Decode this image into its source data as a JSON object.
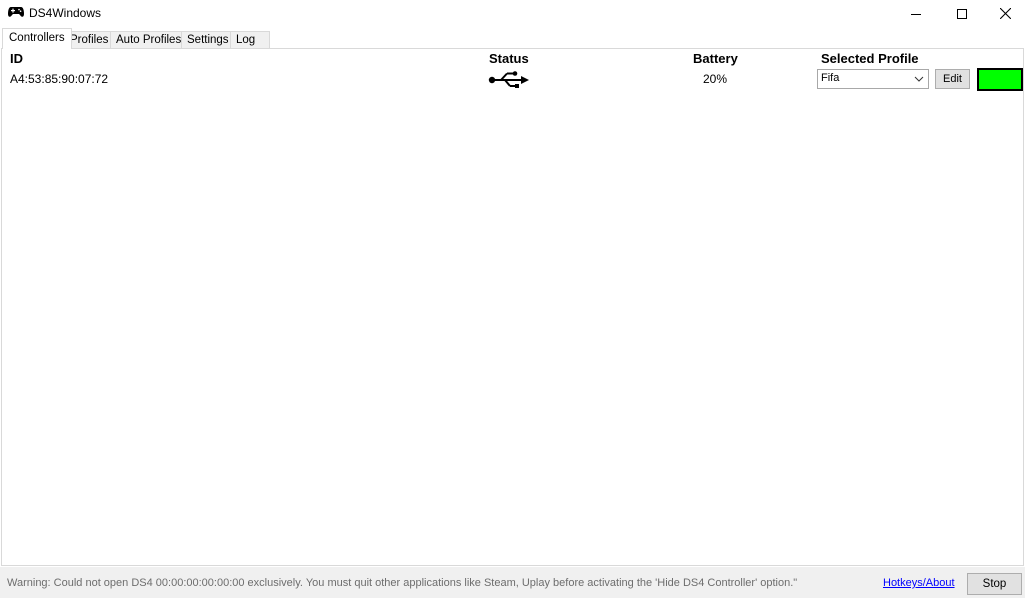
{
  "window": {
    "title": "DS4Windows",
    "icon": "gamepad-icon"
  },
  "tabs": [
    {
      "label": "Controllers",
      "active": true
    },
    {
      "label": "Profiles",
      "active": false
    },
    {
      "label": "Auto Profiles",
      "active": false
    },
    {
      "label": "Settings",
      "active": false
    },
    {
      "label": "Log",
      "active": false
    }
  ],
  "controllers": {
    "headers": {
      "id": "ID",
      "status": "Status",
      "battery": "Battery",
      "selected_profile": "Selected Profile"
    },
    "rows": [
      {
        "id": "A4:53:85:90:07:72",
        "status_icon": "usb-icon",
        "battery": "20%",
        "profile": "Fifa",
        "edit_label": "Edit",
        "light_color": "#00ff00"
      }
    ]
  },
  "statusbar": {
    "message": "Warning: Could not open DS4 00:00:00:00:00:00 exclusively. You must quit other applications like Steam, Uplay before activating the 'Hide DS4 Controller' option.\"",
    "hotkeys_label": "Hotkeys/About",
    "stop_label": "Stop"
  }
}
